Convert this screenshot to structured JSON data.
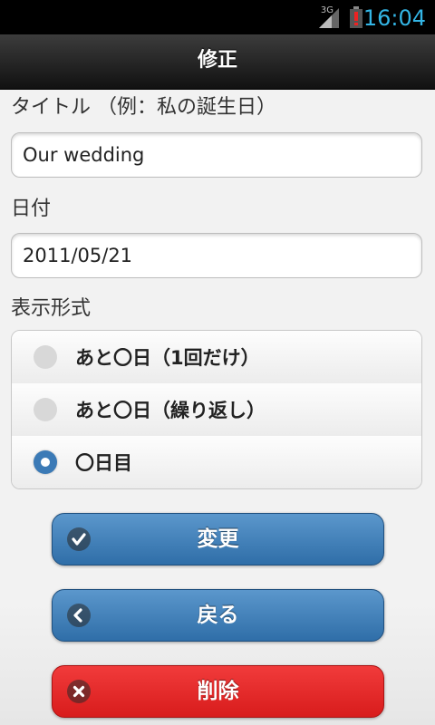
{
  "status_bar": {
    "network": "3G",
    "time": "16:04",
    "accent_color": "#33b5e5"
  },
  "header": {
    "title": "修正"
  },
  "form": {
    "title_label": "タイトル （例：私の誕生日）",
    "title_value": "Our wedding",
    "date_label": "日付",
    "date_value": "2011/05/21",
    "format_label": "表示形式",
    "format_options": [
      {
        "label": "あと〇日（1回だけ）",
        "checked": false
      },
      {
        "label": "あと〇日（繰り返し）",
        "checked": false
      },
      {
        "label": "〇日目",
        "checked": true
      }
    ]
  },
  "buttons": {
    "change": {
      "label": "変更",
      "icon": "check-icon",
      "color": "#3b7ab6"
    },
    "back": {
      "label": "戻る",
      "icon": "chevron-left-icon",
      "color": "#3b7ab6"
    },
    "delete": {
      "label": "削除",
      "icon": "close-icon",
      "color": "#e82020"
    }
  }
}
